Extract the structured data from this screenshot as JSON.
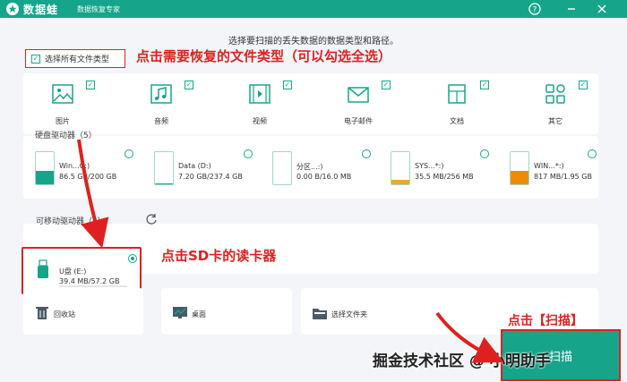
{
  "app": {
    "name": "数据蛙",
    "subtitle": "数据恢复专家"
  },
  "titlebar": {
    "help_icon": "help-circle-icon",
    "minimize_icon": "minimize-icon",
    "close_icon": "close-icon"
  },
  "instruction": "选择要扫描的丢失数据的数据类型和路径。",
  "select_all": {
    "label": "选择所有文件类型",
    "checked": true
  },
  "file_types": [
    {
      "label": "图片",
      "icon": "image-icon",
      "checked": true
    },
    {
      "label": "音频",
      "icon": "music-icon",
      "checked": true
    },
    {
      "label": "视频",
      "icon": "video-icon",
      "checked": true
    },
    {
      "label": "电子邮件",
      "icon": "email-icon",
      "checked": true
    },
    {
      "label": "文档",
      "icon": "document-icon",
      "checked": true
    },
    {
      "label": "其它",
      "icon": "other-icon",
      "checked": true
    }
  ],
  "hard_drives": {
    "title": "硬盘驱动器（5）",
    "items": [
      {
        "name": "Win...C:)",
        "size": "86.5 GB/200 GB",
        "used_fraction": 0.43,
        "color": "#16a58a",
        "selected": false
      },
      {
        "name": "Data (D:)",
        "size": "7.20 GB/237.4 GB",
        "used_fraction": 0.03,
        "color": "#16a58a",
        "selected": false
      },
      {
        "name": "分区...:)",
        "size": "0.00  B/16.0 MB",
        "used_fraction": 0.0,
        "color": "#16a58a",
        "selected": false
      },
      {
        "name": "SYS...*:)",
        "size": "35.5 MB/256 MB",
        "used_fraction": 0.14,
        "color": "#f5a623",
        "selected": false
      },
      {
        "name": "WIN...*:)",
        "size": "817 MB/1.95 GB",
        "used_fraction": 0.42,
        "color": "#f08a00",
        "selected": false
      }
    ]
  },
  "removable": {
    "title": "可移动驱动器（1）",
    "refresh_icon": "refresh-icon",
    "items": [
      {
        "name": "U盘 (E:)",
        "size": "39.4 MB/57.2 GB",
        "selected": true,
        "icon": "usb-drive-icon"
      }
    ]
  },
  "locations": [
    {
      "label": "回收站",
      "icon": "recycle-bin-icon"
    },
    {
      "label": "桌面",
      "icon": "desktop-icon"
    },
    {
      "label": "选择文件夹",
      "icon": "folder-icon"
    }
  ],
  "annotations": {
    "file_type_hint": "点击需要恢复的文件类型（可以勾选全选）",
    "sd_hint": "点击SD卡的读卡器",
    "scan_hint": "点击【扫描】"
  },
  "scan_button": {
    "label": "扫描"
  },
  "watermark": "掘金技术社区 @ 小明助手",
  "colors": {
    "brand": "#16a58a",
    "annotation": "#e02020"
  }
}
